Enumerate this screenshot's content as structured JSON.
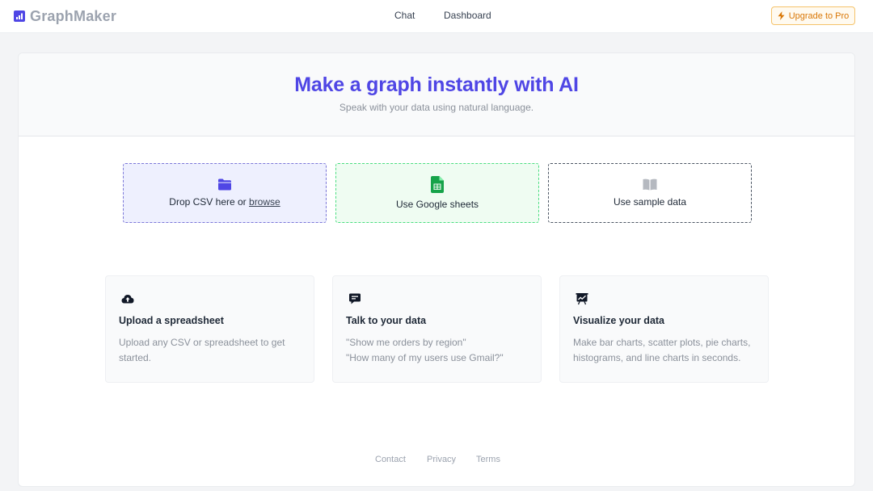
{
  "header": {
    "brand": "GraphMaker",
    "nav": [
      {
        "label": "Chat"
      },
      {
        "label": "Dashboard"
      }
    ],
    "upgrade_label": "Upgrade to Pro"
  },
  "hero": {
    "title": "Make a graph instantly with AI",
    "subtitle": "Speak with your data using natural language."
  },
  "sources": {
    "csv_text": "Drop CSV here or ",
    "csv_link": "browse",
    "sheets_label": "Use Google sheets",
    "sample_label": "Use sample data"
  },
  "features": [
    {
      "title": "Upload a spreadsheet",
      "lines": [
        "Upload any CSV or spreadsheet to get",
        "started."
      ],
      "icon": "cloud-upload-icon"
    },
    {
      "title": "Talk to your data",
      "lines": [
        "\"Show me orders by region\"",
        "\"How many of my users use Gmail?\""
      ],
      "icon": "chat-bubble-icon"
    },
    {
      "title": "Visualize your data",
      "lines": [
        "Make bar charts, scatter plots, pie charts,",
        "histograms, and line charts in seconds."
      ],
      "icon": "presentation-chart-icon"
    }
  ],
  "footer": {
    "links": [
      {
        "label": "Contact"
      },
      {
        "label": "Privacy"
      },
      {
        "label": "Terms"
      }
    ]
  },
  "colors": {
    "accent": "#4f46e5",
    "sheets_green": "#16a34a",
    "upgrade_orange": "#d97706"
  }
}
